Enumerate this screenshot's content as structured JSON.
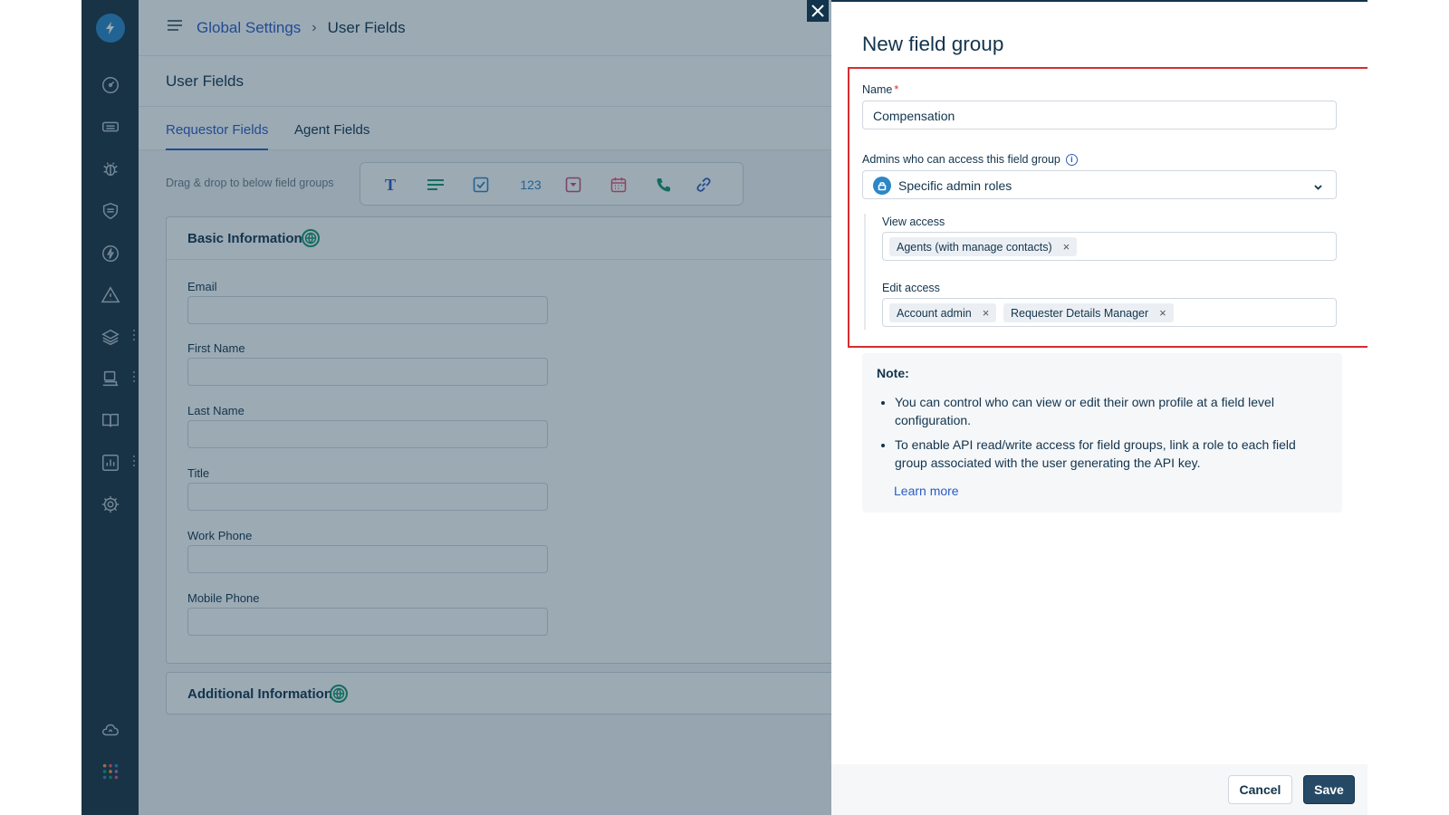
{
  "header": {
    "breadcrumb_parent": "Global Settings",
    "breadcrumb_separator": "›",
    "breadcrumb_current": "User Fields"
  },
  "page": {
    "title": "User Fields",
    "tabs": [
      {
        "label": "Requestor Fields",
        "active": true
      },
      {
        "label": "Agent Fields",
        "active": false
      }
    ],
    "toolbar_hint": "Drag & drop to below field groups",
    "palette": [
      "text-field-icon",
      "paragraph-icon",
      "checkbox-icon",
      "number-icon",
      "dropdown-icon",
      "date-icon",
      "phone-icon",
      "url-icon"
    ],
    "palette_number_label": "123",
    "palette_text_label": "T",
    "sections": [
      {
        "title": "Basic Information",
        "fields": [
          "Email",
          "First Name",
          "Last Name",
          "Title",
          "Work Phone",
          "Mobile Phone"
        ]
      },
      {
        "title": "Additional Information",
        "fields": []
      }
    ]
  },
  "panel": {
    "title": "New field group",
    "name_label": "Name",
    "name_required_marker": "*",
    "name_value": "Compensation",
    "admins_label": "Admins who can access this field group",
    "admins_info_icon": "i",
    "admins_value": "Specific admin roles",
    "view_access_label": "View access",
    "view_access_chips": [
      "Agents (with manage contacts)"
    ],
    "edit_access_label": "Edit access",
    "edit_access_chips": [
      "Account admin",
      "Requester Details Manager"
    ],
    "chip_remove": "×",
    "note": {
      "title": "Note:",
      "items": [
        "You can control who can view or edit their own profile at a field level configuration.",
        "To enable API read/write access for field groups, link a role to each field group associated with the user generating the API key."
      ],
      "link": "Learn more"
    },
    "cancel_label": "Cancel",
    "save_label": "Save"
  },
  "colors": {
    "accent": "#2c5cc5",
    "nav_bg": "#1d3340",
    "highlight": "#d72d30",
    "save_bg": "#264966",
    "globe": "#16956e"
  }
}
